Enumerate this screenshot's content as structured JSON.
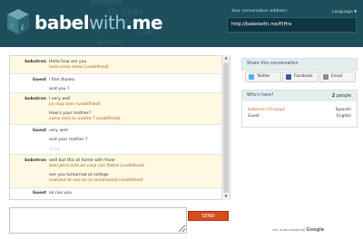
{
  "header": {
    "brand_main": "babel",
    "brand_with": "with",
    "brand_end": ".me",
    "background_words": [
      "Bonjour",
      "Xin Chào",
      "Hallo",
      "Ciao",
      "Aloha",
      "Hola",
      "Olá",
      "Namaste",
      "Hello"
    ],
    "address_label": "Your conversation address:",
    "address_value": "http://babelwith.me/PjHrx",
    "language_label": "Language",
    "language_arrow": "▼"
  },
  "chat": {
    "messages": [
      {
        "sender": "bobotron",
        "lines": [
          "Hello how are you"
        ],
        "translation": "hola como estas (undefined)"
      },
      {
        "sender": "Guest",
        "lines": [
          "i fine thanks",
          "and you ?"
        ],
        "translation": ""
      },
      {
        "sender": "bobotron",
        "lines": [
          "I very well"
        ],
        "translation": "yo muy bien (undefined)",
        "extra": "How's your mother?",
        "extra_translation": "como esta tu madre ? (undefined)"
      },
      {
        "sender": "Guest",
        "lines": [
          "very well",
          "and your mother ?"
        ],
        "time": "17:16"
      },
      {
        "sender": "bobotron",
        "lines": [
          "well but this at home with fever"
        ],
        "translation": "bien pero esta en casa con fiebre (undefined)",
        "extra": "see you tomorrow at college",
        "extra_translation": "mañana te veo en la universidad (undefined)"
      },
      {
        "sender": "Guest",
        "lines": [
          "ok.nos you"
        ],
        "translation": ""
      }
    ],
    "send_label": "SEND"
  },
  "sidebar": {
    "share_title": "Share this conversation",
    "share_buttons": [
      {
        "label": "Twitter",
        "icon": "twitter-icon",
        "color": "#55acee"
      },
      {
        "label": "Facebook",
        "icon": "facebook-icon",
        "color": "#3b5998"
      },
      {
        "label": "Email",
        "icon": "email-icon",
        "color": "#8a8a8a"
      }
    ],
    "who_title": "Who's here?",
    "people_count": "2",
    "people_label": "people",
    "users": [
      {
        "name": "bobotron",
        "action": "(Change)",
        "language": "Spanish"
      },
      {
        "name": "Guest",
        "action": "",
        "language": "English"
      }
    ],
    "powered_by": "con la tecnología de",
    "google": "Google"
  }
}
